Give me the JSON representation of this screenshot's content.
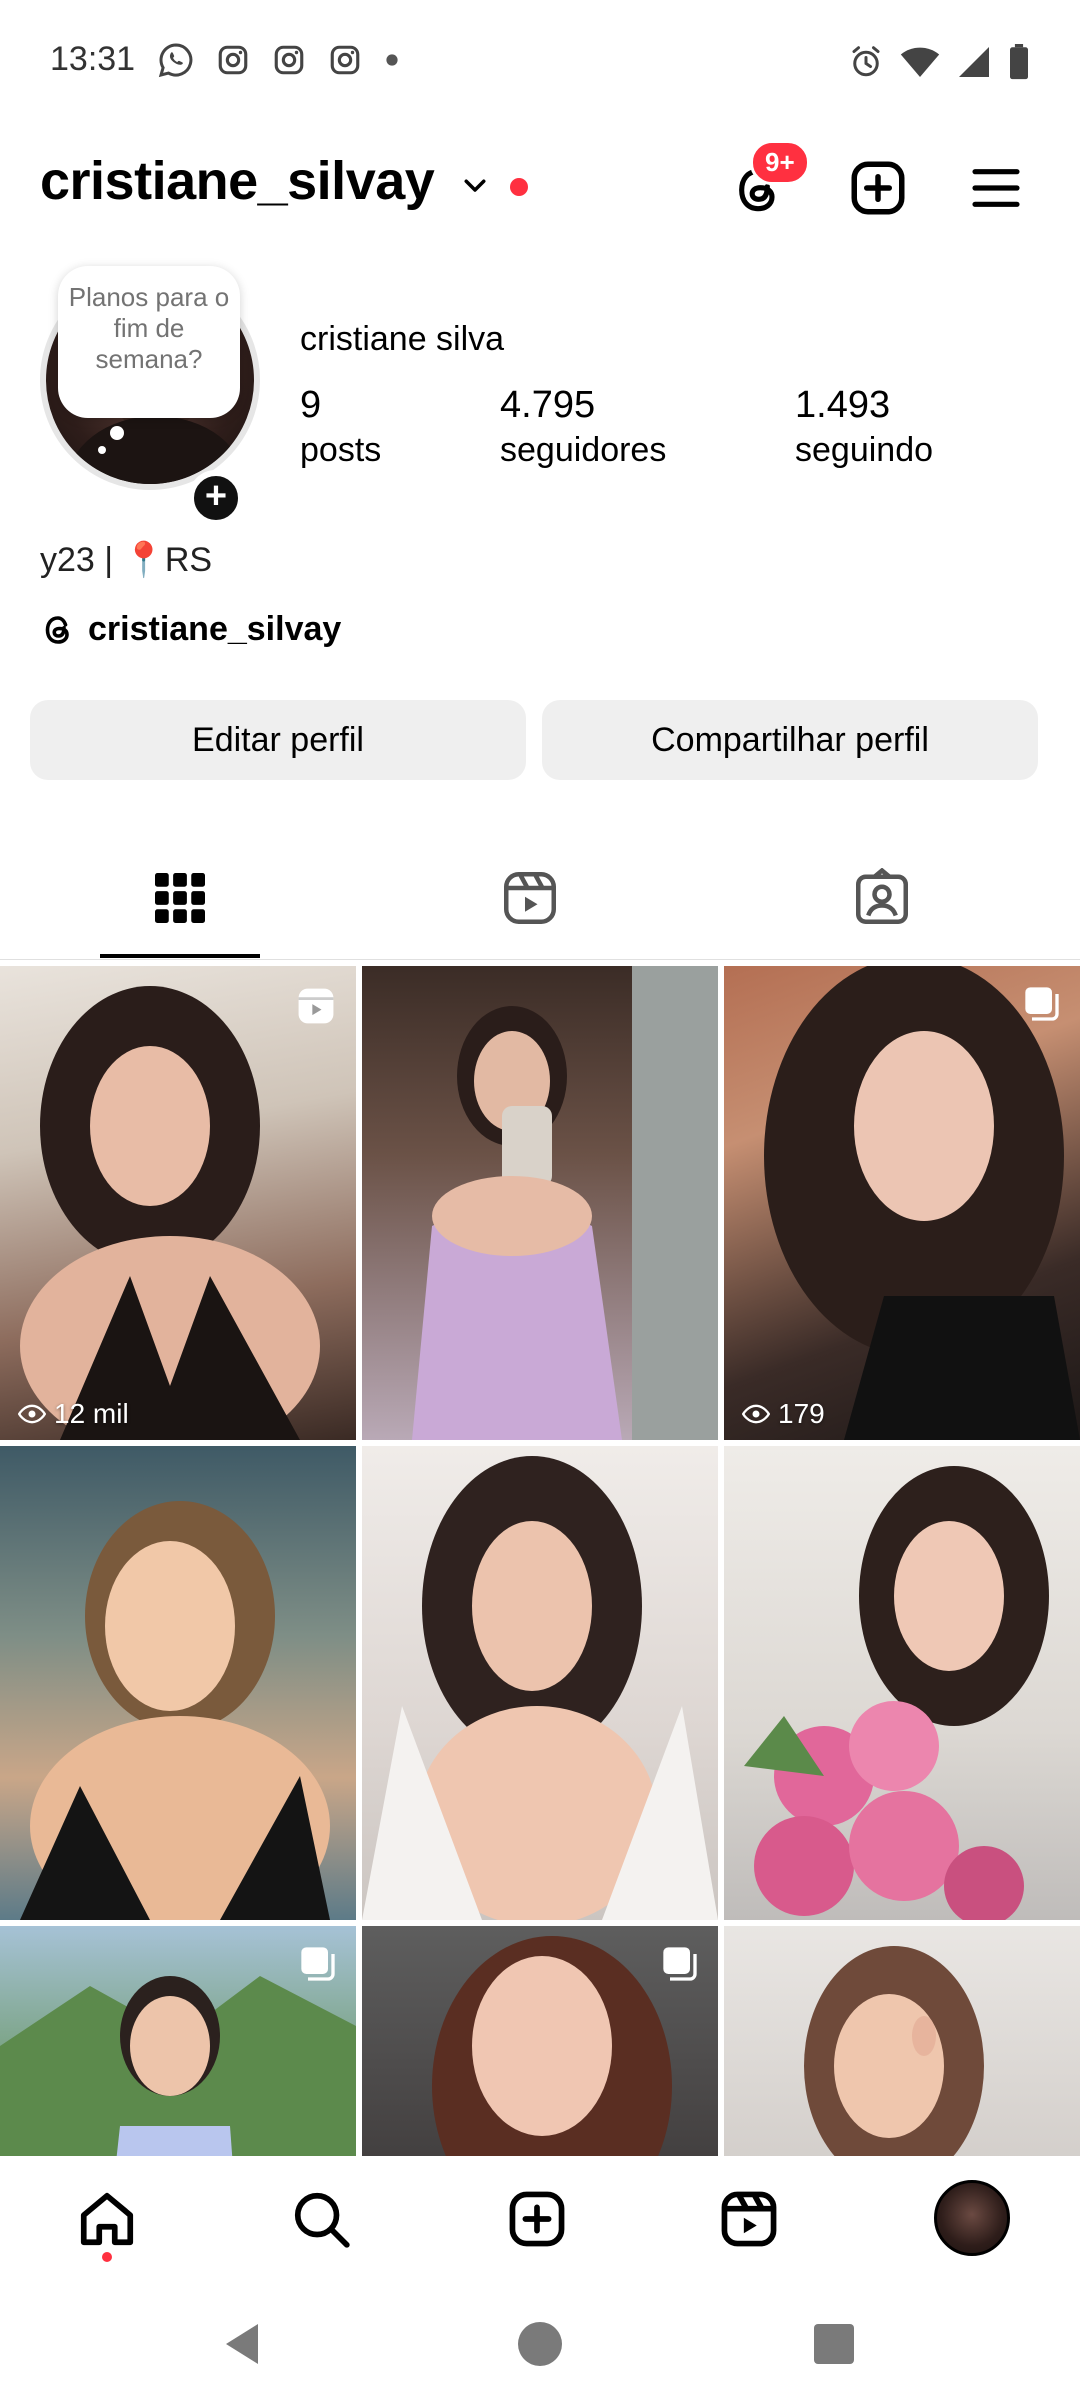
{
  "status_bar": {
    "time": "13:31",
    "app_icons": [
      "whatsapp-icon",
      "instagram-icon",
      "instagram-icon",
      "instagram-icon"
    ],
    "right_icons": [
      "alarm-icon",
      "wifi-icon",
      "signal-icon",
      "battery-icon"
    ]
  },
  "header": {
    "username": "cristiane_silvay",
    "threads_badge": "9+"
  },
  "profile": {
    "note": "Planos para o fim de semana?",
    "full_name": "cristiane silva",
    "stats": [
      {
        "value": "9",
        "label": "posts"
      },
      {
        "value": "4.795",
        "label": "seguidores"
      },
      {
        "value": "1.493",
        "label": "seguindo"
      }
    ],
    "bio": "y23 |  📍RS",
    "threads_handle": "cristiane_silvay"
  },
  "buttons": {
    "edit": "Editar perfil",
    "share": "Compartilhar perfil"
  },
  "grid": {
    "posts": [
      {
        "views": "12 mil",
        "type": "reel"
      },
      {
        "views": "",
        "type": "photo"
      },
      {
        "views": "179",
        "type": "carousel"
      },
      {
        "views": "",
        "type": "photo"
      },
      {
        "views": "",
        "type": "photo"
      },
      {
        "views": "",
        "type": "photo"
      },
      {
        "views": "",
        "type": "carousel"
      },
      {
        "views": "",
        "type": "carousel"
      },
      {
        "views": "",
        "type": "photo"
      }
    ]
  },
  "colors": {
    "accent_red": "#ff3040",
    "button_bg": "#efefef"
  }
}
